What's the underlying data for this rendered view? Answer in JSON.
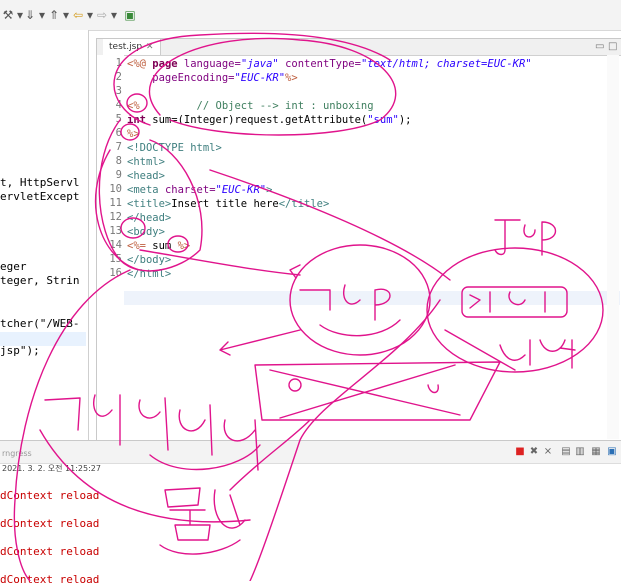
{
  "toolbar": {
    "icons": [
      "build-icon",
      "dropdown-icon",
      "next-annotation-icon",
      "dropdown-icon",
      "back-arrow-icon",
      "dropdown-icon",
      "forward-arrow-icon",
      "dropdown-icon",
      "pin-editor-icon"
    ]
  },
  "left_pane": {
    "lines": [
      "t, HttpServl",
      "ervletExcept",
      "eger",
      "teger, Strin",
      "tcher(\"/WEB-",
      "jsp\");"
    ]
  },
  "editor": {
    "tab_label": "test.jsp",
    "tab_close": "✕",
    "line_numbers": [
      "1",
      "2",
      "3",
      "4",
      "5",
      "6",
      "7",
      "8",
      "9",
      "10",
      "11",
      "12",
      "13",
      "14",
      "15",
      "16"
    ],
    "lines": {
      "l1_open": "<%@ ",
      "l1_page": "page",
      "l1_lang_attr": " language=",
      "l1_lang_val": "\"java\"",
      "l1_ct_attr": " contentType=",
      "l1_ct_val": "\"text/html; charset=EUC-KR\"",
      "l2_attr": "    pageEncoding=",
      "l2_val": "\"EUC-KR\"",
      "l2_close": "%>",
      "l3": "",
      "l4_open": "<%",
      "l4_comment": "         // Object --> int : unboxing",
      "l5_type": "int",
      "l5_rest": " sum=(Integer)request.getAttribute(",
      "l5_str": "\"sum\"",
      "l5_end": ");",
      "l6": "%>",
      "l7": "<!DOCTYPE html>",
      "l8": "<html>",
      "l9": "<head>",
      "l10_tag": "<meta ",
      "l10_attr": "charset=",
      "l10_val": "\"EUC-KR\"",
      "l10_end": ">",
      "l11_open": "<title>",
      "l11_text": "Insert title here",
      "l11_close": "</title>",
      "l12": "</head>",
      "l13": "<body>",
      "l14_open": "<%=",
      "l14_expr": " sum ",
      "l14_close": "%>",
      "l15": "</body>",
      "l16": "</html>"
    }
  },
  "console": {
    "title": "rngress",
    "timestamp": "2021. 3. 2. 오전 11:25:27",
    "lines": [
      "dContext reload",
      "dContext reload",
      "dContext reload",
      "dContext reload"
    ]
  },
  "handwriting": {
    "jsp_top": "JSP",
    "jsp_center": "JSP",
    "korean_right_1": "자바",
    "korean_right_2": "개발자",
    "korean_left": "디자이너",
    "korean_bottom": "모름"
  }
}
